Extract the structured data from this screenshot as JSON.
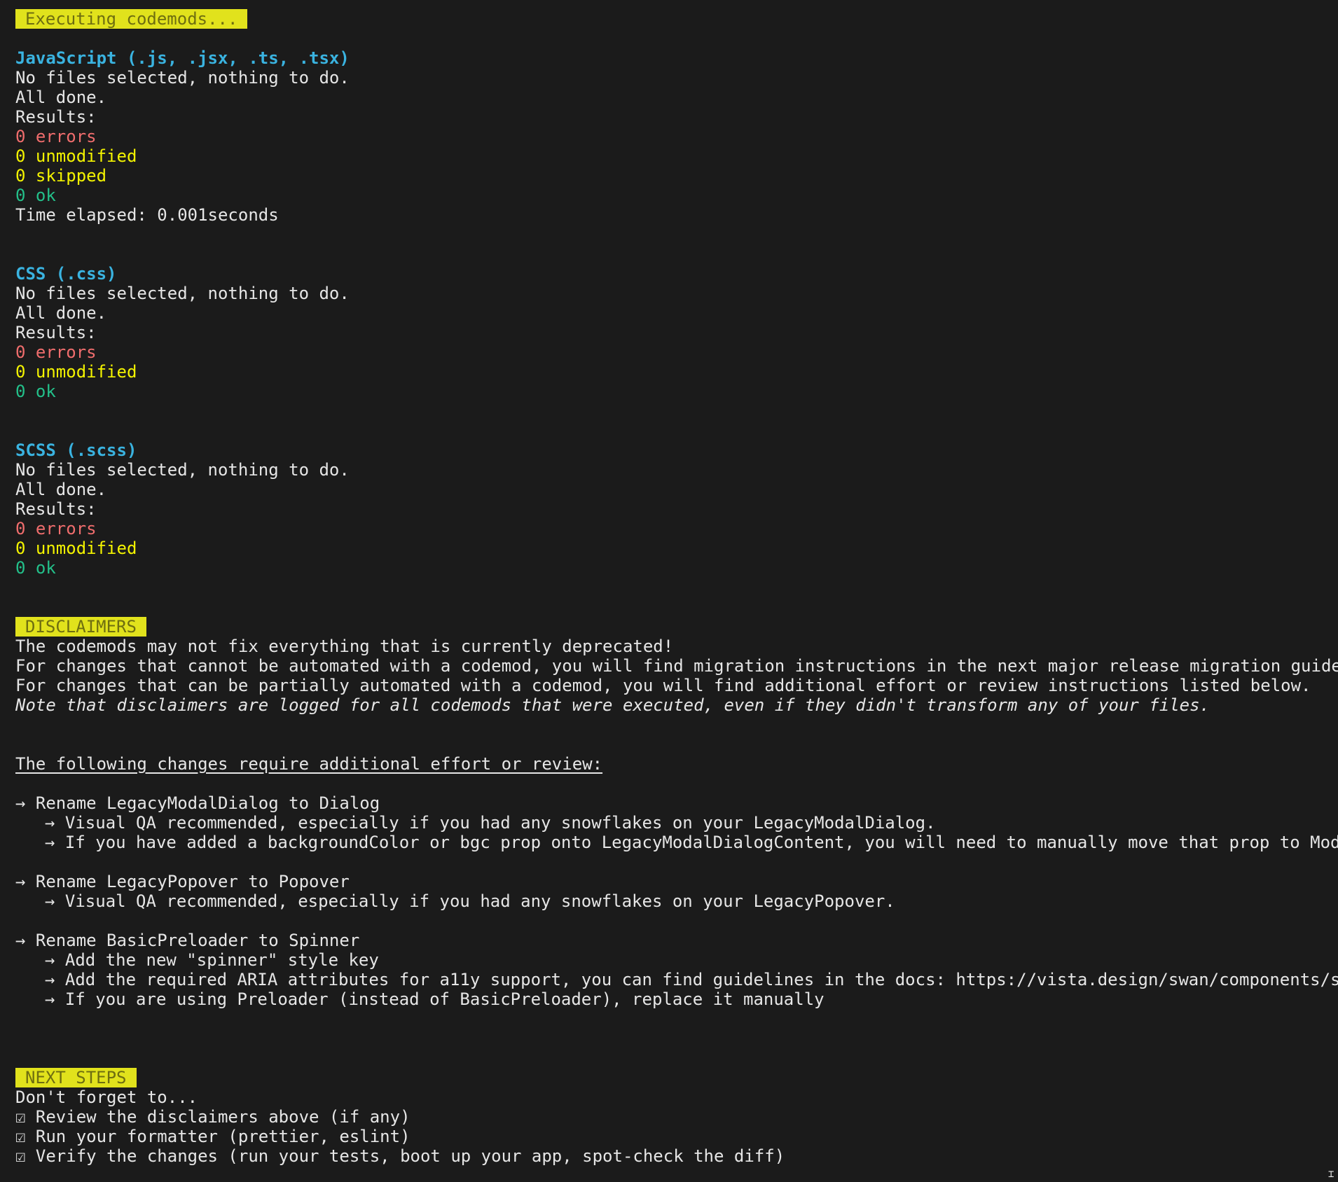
{
  "executing_banner": "Executing codemods...",
  "sections": [
    {
      "heading": "JavaScript (.js, .jsx, .ts, .tsx)",
      "no_files": "No files selected, nothing to do.",
      "all_done": "All done.",
      "results_label": "Results:",
      "errors": "0 errors",
      "unmodified": "0 unmodified",
      "skipped": "0 skipped",
      "ok": "0 ok",
      "time_elapsed": "Time elapsed: 0.001seconds"
    },
    {
      "heading": "CSS (.css)",
      "no_files": "No files selected, nothing to do.",
      "all_done": "All done.",
      "results_label": "Results:",
      "errors": "0 errors",
      "unmodified": "0 unmodified",
      "ok": "0 ok"
    },
    {
      "heading": "SCSS (.scss)",
      "no_files": "No files selected, nothing to do.",
      "all_done": "All done.",
      "results_label": "Results:",
      "errors": "0 errors",
      "unmodified": "0 unmodified",
      "ok": "0 ok"
    }
  ],
  "disclaimers": {
    "banner": "DISCLAIMERS",
    "line1": "The codemods may not fix everything that is currently deprecated!",
    "line2": "For changes that cannot be automated with a codemod, you will find migration instructions in the next major release migration guide.",
    "line3": "For changes that can be partially automated with a codemod, you will find additional effort or review instructions listed below.",
    "note": "Note that disclaimers are logged for all codemods that were executed, even if they didn't transform any of your files.",
    "review_heading": "The following changes require additional effort or review:",
    "items": [
      {
        "title": "→ Rename LegacyModalDialog to Dialog",
        "subs": [
          "→ Visual QA recommended, especially if you had any snowflakes on your LegacyModalDialog.",
          "→ If you have added a backgroundColor or bgc prop onto LegacyModalDialogContent, you will need to manually move that prop to ModalDi"
        ]
      },
      {
        "title": "→ Rename LegacyPopover to Popover",
        "subs": [
          "→ Visual QA recommended, especially if you had any snowflakes on your LegacyPopover."
        ]
      },
      {
        "title": "→ Rename BasicPreloader to Spinner",
        "subs": [
          "→ Add the new \"spinner\" style key",
          "→ Add the required ARIA attributes for a11y support, you can find guidelines in the docs: https://vista.design/swan/components/spinn",
          "→ If you are using Preloader (instead of BasicPreloader), replace it manually"
        ]
      }
    ]
  },
  "next_steps": {
    "banner": "NEXT STEPS",
    "intro": "Don't forget to...",
    "items": [
      "☑ Review the disclaimers above (if any)",
      "☑ Run your formatter (prettier, eslint)",
      "☑ Verify the changes (run your tests, boot up your app, spot-check the diff)"
    ]
  },
  "colors": {
    "background": "#1b1b1b",
    "banner_bg": "#e1e21c",
    "heading": "#3ab3e0",
    "error": "#f06d6d",
    "warning": "#f3f300",
    "ok": "#23c08a"
  }
}
